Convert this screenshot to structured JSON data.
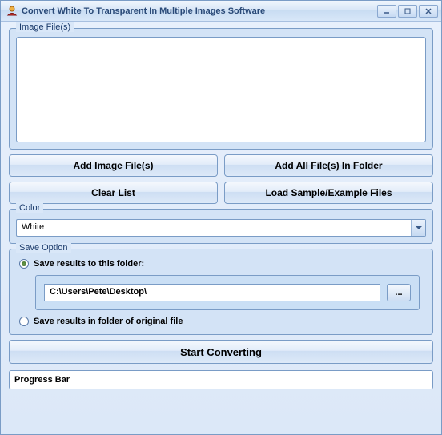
{
  "titlebar": {
    "title": "Convert White To Transparent In Multiple Images Software"
  },
  "fileGroup": {
    "legend": "Image File(s)"
  },
  "buttons": {
    "addFiles": "Add Image File(s)",
    "addFolder": "Add All File(s) In Folder",
    "clearList": "Clear List",
    "loadSample": "Load Sample/Example Files",
    "browse": "...",
    "start": "Start Converting"
  },
  "colorGroup": {
    "legend": "Color",
    "selected": "White"
  },
  "saveGroup": {
    "legend": "Save Option",
    "option1": "Save results to this folder:",
    "option2": "Save results in folder of original file",
    "path": "C:\\Users\\Pete\\Desktop\\"
  },
  "progress": {
    "label": "Progress Bar"
  }
}
